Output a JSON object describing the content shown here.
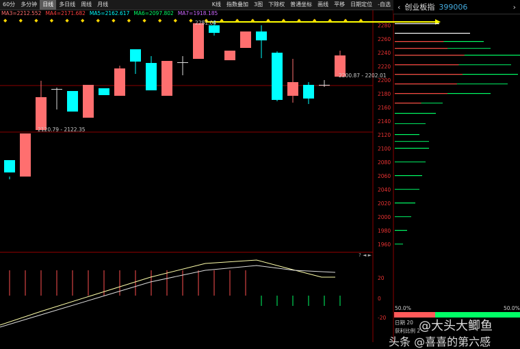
{
  "toolbar": {
    "periods": [
      "60分",
      "多分钟",
      "日线",
      "多日线",
      "周线",
      "月线"
    ],
    "active_period": "日线",
    "right": [
      "K线",
      "指数叠加",
      "3图",
      "下除权",
      "普通坐标",
      "画线",
      "平移",
      "日期定位",
      "-自选"
    ]
  },
  "ma": {
    "ma3": "MA3=2212.552",
    "ma4": "MA4=2171.682",
    "ma5": "MA5=2162.617",
    "ma6": "MA6=2097.802",
    "ma7": "MA7=1918.185",
    "colors": {
      "ma3": "#ff6f6f",
      "ma4": "#ff4040",
      "ma5": "#00ffff",
      "ma6": "#00ff66",
      "ma7": "#cc66ff"
    }
  },
  "price_labels": [
    "2280",
    "2260",
    "2240",
    "2220",
    "2200",
    "2180",
    "2160",
    "2140",
    "2120",
    "2100",
    "2080",
    "2060",
    "2040",
    "2020",
    "2000",
    "1980",
    "1960"
  ],
  "annotations": {
    "high": "2281.04",
    "range1": "2120.79 - 2122.35",
    "range2": "2200.87 - 2202.01"
  },
  "sub_labels": [
    "20",
    "0",
    "-20"
  ],
  "right_panel": {
    "name": "创业板指",
    "code": "399006",
    "pct_left": "50.0%",
    "pct_right": "50.0%",
    "date_label": "日期",
    "profit_label": "获利比例",
    "date_value": "20",
    "profit_value": "2"
  },
  "watermark": {
    "line1": "@大头大鲫鱼",
    "line2": "头条 @喜喜的第六感"
  },
  "colors": {
    "up": "#ff5a5a",
    "down": "#00ffff",
    "grid": "#8b0000",
    "text": "#cc3333"
  }
}
